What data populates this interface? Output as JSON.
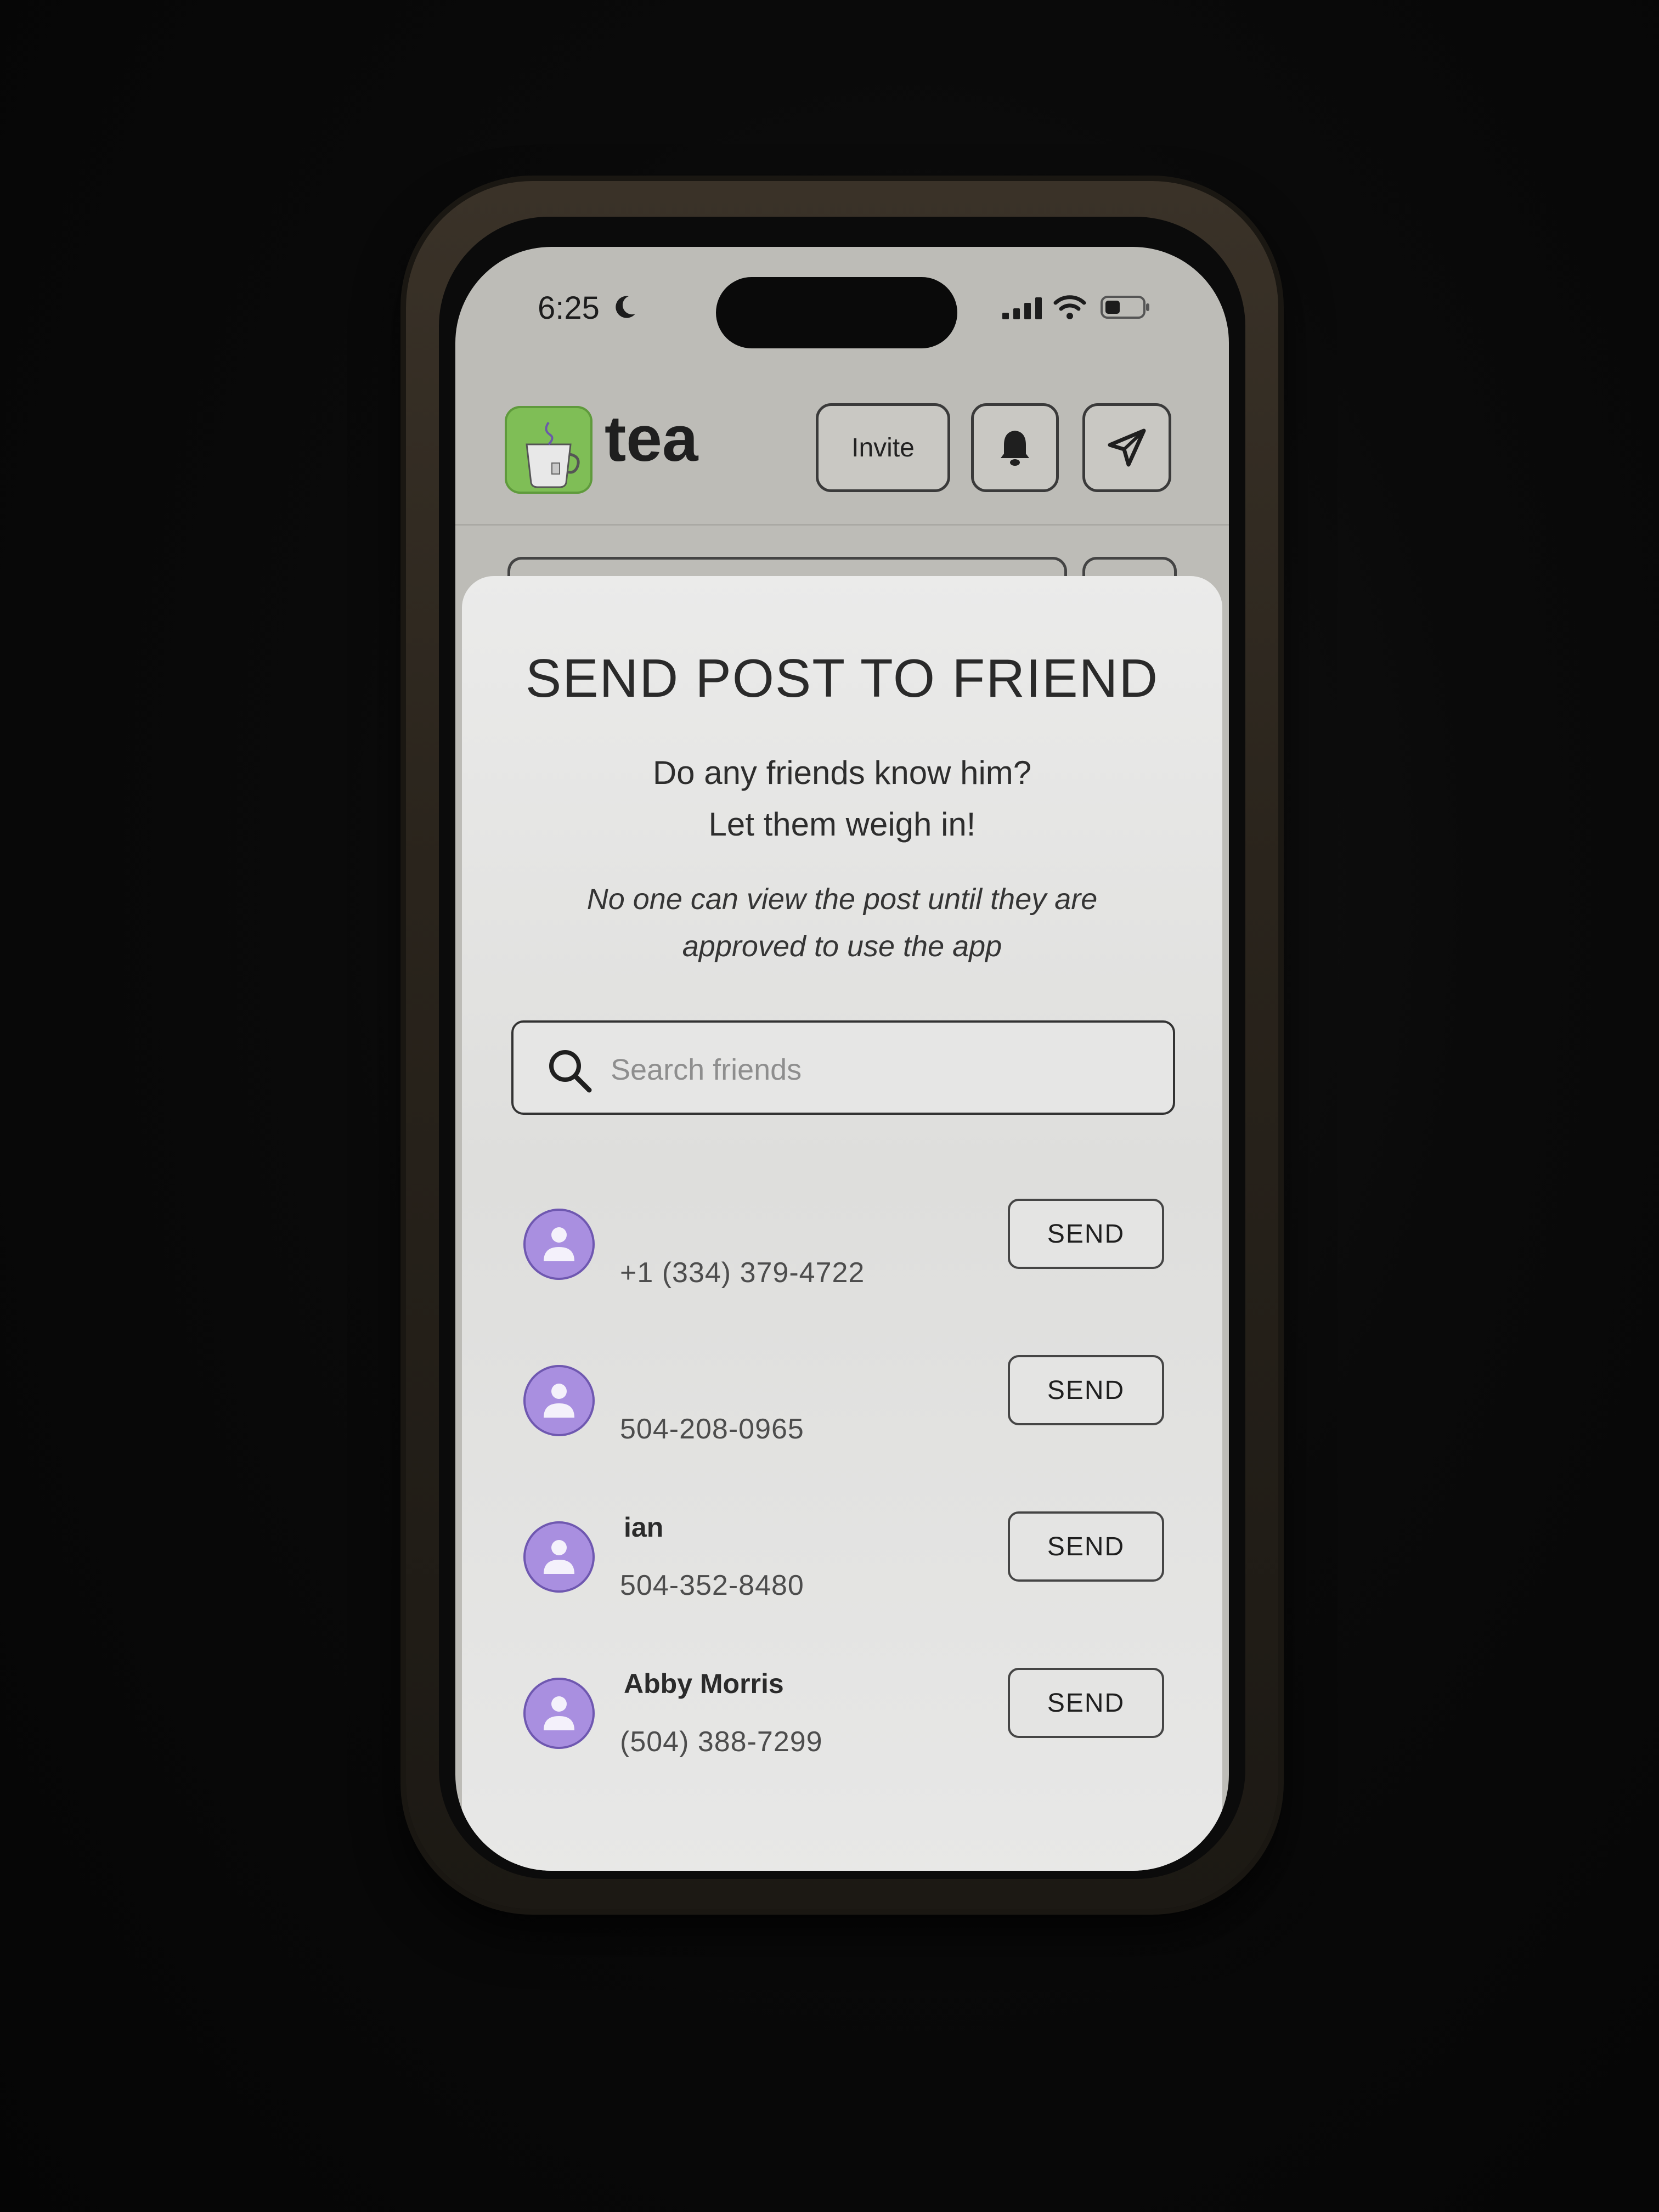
{
  "status_bar": {
    "time": "6:25",
    "moon_icon": "moon-icon",
    "signal_icon": "cellular-signal-icon",
    "wifi_icon": "wifi-icon",
    "battery_icon": "battery-icon"
  },
  "header": {
    "logo_text": "tea",
    "logo_icon": "teacup-icon",
    "invite_label": "Invite",
    "bell_icon": "bell-icon",
    "send_icon": "paper-plane-icon",
    "logo_color": "#7fbe56"
  },
  "modal": {
    "title": "SEND POST TO FRIEND",
    "subtitle_line1": "Do any friends know him?",
    "subtitle_line2": "Let them weigh in!",
    "note_line1": "No one can view the post until they are",
    "note_line2": "approved to use the app",
    "search_placeholder": "Search friends",
    "search_value": "",
    "avatar_color": "#a98fe0",
    "contacts": [
      {
        "name": "",
        "phone": "+1 (334) 379-4722",
        "send_label": "SEND"
      },
      {
        "name": "",
        "phone": "504-208-0965",
        "send_label": "SEND"
      },
      {
        "name": "ian",
        "phone": "504-352-8480",
        "send_label": "SEND"
      },
      {
        "name": "Abby Morris",
        "phone": "(504) 388-7299",
        "send_label": "SEND"
      }
    ]
  }
}
